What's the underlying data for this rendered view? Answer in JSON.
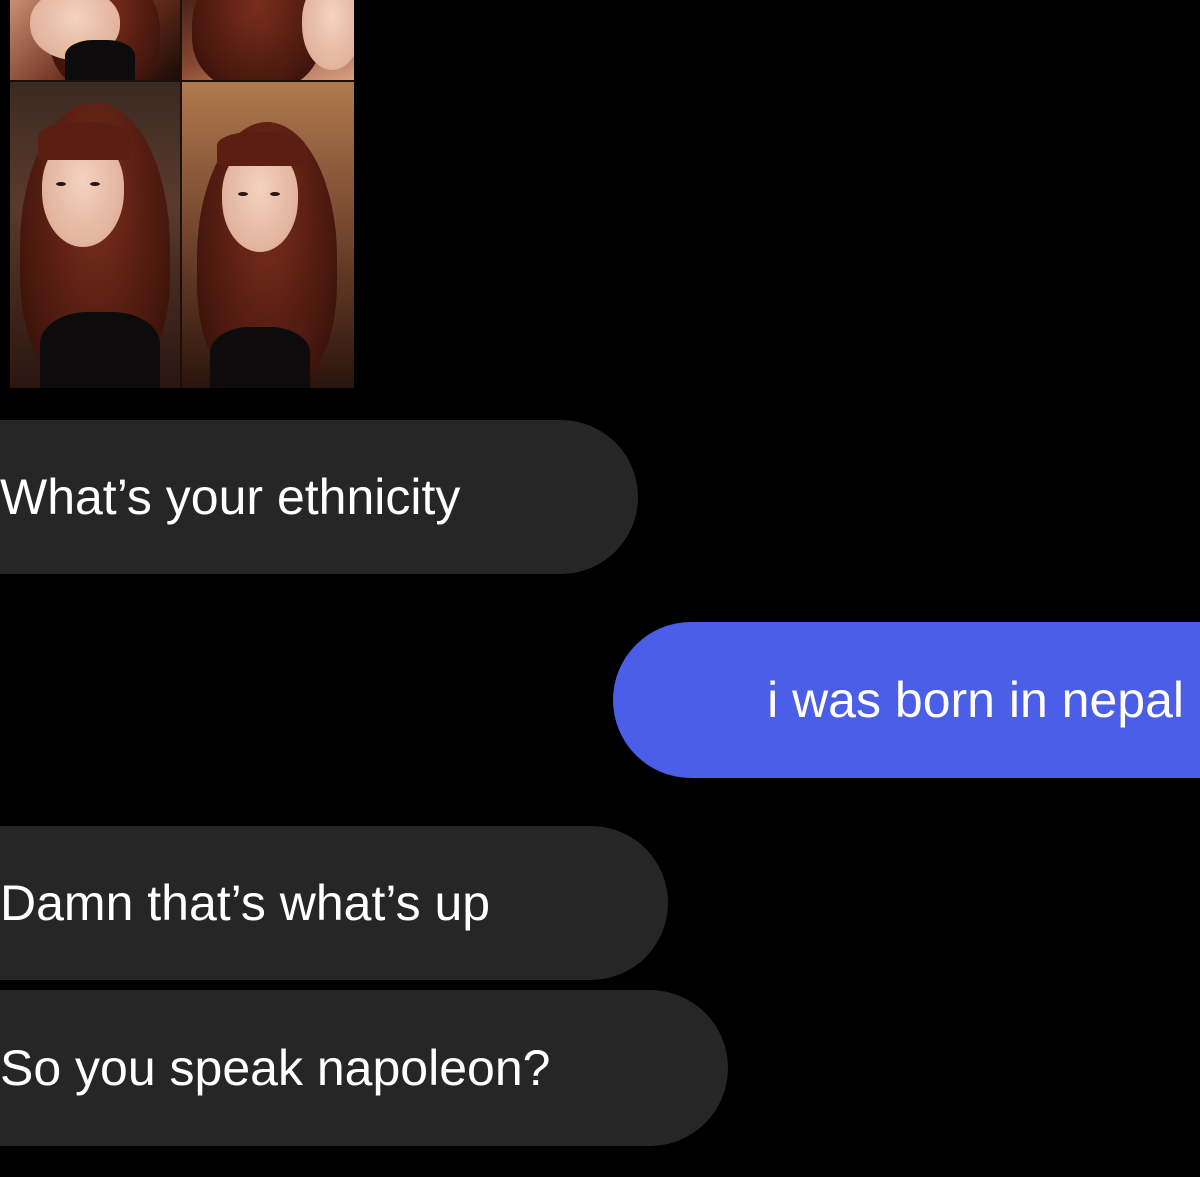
{
  "conversation": {
    "shared_photos": {
      "count": 4,
      "icon": "photo-collage"
    },
    "messages": [
      {
        "sender": "them",
        "text": "What’s your ethnicity"
      },
      {
        "sender": "me",
        "text": "i was born in nepal"
      },
      {
        "sender": "them",
        "text": "Damn that’s what’s up"
      },
      {
        "sender": "them",
        "text": "So you speak napoleon?"
      }
    ]
  },
  "theme": {
    "background": "#000000",
    "incoming_bubble": "#262626",
    "outgoing_bubble": "#4b5ee8",
    "text": "#ffffff"
  }
}
